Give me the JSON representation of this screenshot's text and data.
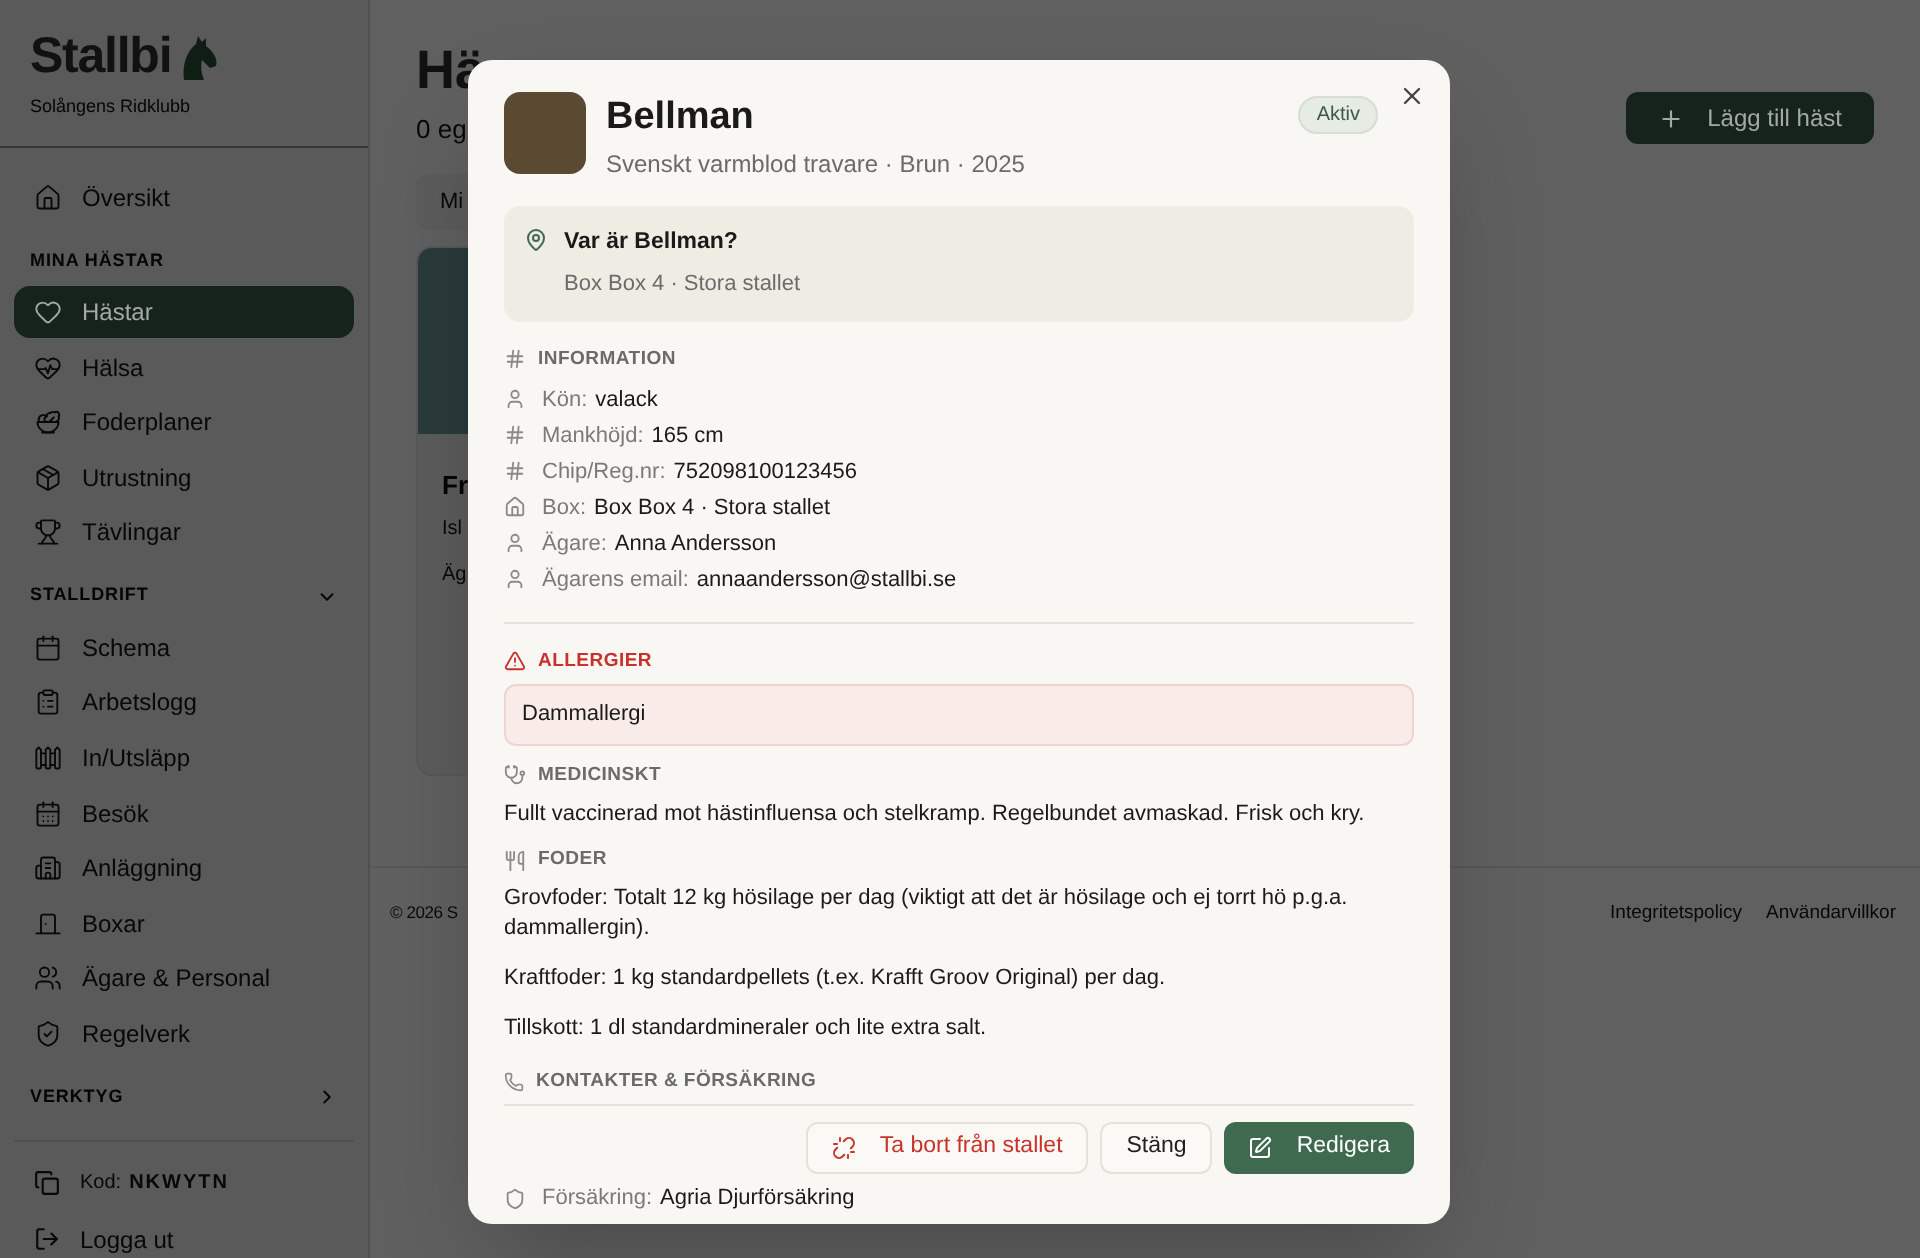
{
  "sidebar": {
    "brand": "Stallbi",
    "org": "Solångens Ridklubb",
    "top_items": [
      {
        "label": "Översikt",
        "selected": false
      }
    ],
    "sections": [
      {
        "title": "MINA HÄSTAR",
        "items": [
          {
            "label": "Hästar",
            "selected": true
          },
          {
            "label": "Hälsa",
            "selected": false
          },
          {
            "label": "Foderplaner",
            "selected": false
          },
          {
            "label": "Utrustning",
            "selected": false
          },
          {
            "label": "Tävlingar",
            "selected": false
          }
        ]
      },
      {
        "title": "STALLDRIFT",
        "expanded": true,
        "items": [
          {
            "label": "Schema",
            "selected": false
          },
          {
            "label": "Arbetslogg",
            "selected": false
          },
          {
            "label": "In/Utsläpp",
            "selected": false
          },
          {
            "label": "Besök",
            "selected": false
          },
          {
            "label": "Anläggning",
            "selected": false
          },
          {
            "label": "Boxar",
            "selected": false
          },
          {
            "label": "Ägare & Personal",
            "selected": false
          },
          {
            "label": "Regelverk",
            "selected": false
          }
        ]
      },
      {
        "title": "VERKTYG",
        "expanded": false
      }
    ],
    "code_label": "Kod:",
    "code": "NKWYTN",
    "logout": "Logga ut"
  },
  "main": {
    "title": "Hä",
    "subtitle": "0 eg",
    "filter": "Mi",
    "add_button": "Lägg till häst",
    "card": {
      "name": "Fr",
      "line_1": "Isl",
      "line_2": "Äg"
    },
    "footer": {
      "copyright": "© 2026 S",
      "links": [
        "Integritetspolicy",
        "Användarvillkor"
      ]
    }
  },
  "modal": {
    "name": "Bellman",
    "meta": "Svenskt varmblod travare · Brun · 2025",
    "status": "Aktiv",
    "location": {
      "title": "Var är Bellman?",
      "value": "Box Box 4 · Stora stallet"
    },
    "info_title": "INFORMATION",
    "info": [
      {
        "label": "Kön:",
        "value": "valack"
      },
      {
        "label": "Mankhöjd:",
        "value": "165 cm"
      },
      {
        "label": "Chip/Reg.nr:",
        "value": "752098100123456"
      },
      {
        "label": "Box:",
        "value": "Box Box 4 · Stora stallet"
      },
      {
        "label": "Ägare:",
        "value": "Anna Andersson"
      },
      {
        "label": "Ägarens email:",
        "value": "annaandersson@stallbi.se"
      }
    ],
    "allergies_title": "ALLERGIER",
    "allergies": "Dammallergi",
    "medical_title": "MEDICINSKT",
    "medical": "Fullt vaccinerad mot hästinfluensa och stelkramp. Regelbundet avmaskad. Frisk och kry.",
    "feed_title": "FODER",
    "feed": [
      "Grovfoder: Totalt 12 kg hösilage per dag (viktigt att det är hösilage och ej torrt hö p.g.a. dammallergin).",
      "Kraftfoder: 1 kg standardpellets (t.ex. Krafft Groov Original) per dag.",
      "Tillskott: 1 dl standardmineraler och lite extra salt."
    ],
    "contacts_title": "KONTAKTER & FÖRSÄKRING",
    "contacts": [
      {
        "label": "Försäkring:",
        "value": "Agria Djurförsäkring"
      }
    ],
    "buttons": [
      {
        "kind": "danger",
        "label": "Ta bort från stallet"
      },
      {
        "kind": "plain",
        "label": "Stäng"
      },
      {
        "kind": "primary",
        "label": "Redigera"
      }
    ]
  }
}
